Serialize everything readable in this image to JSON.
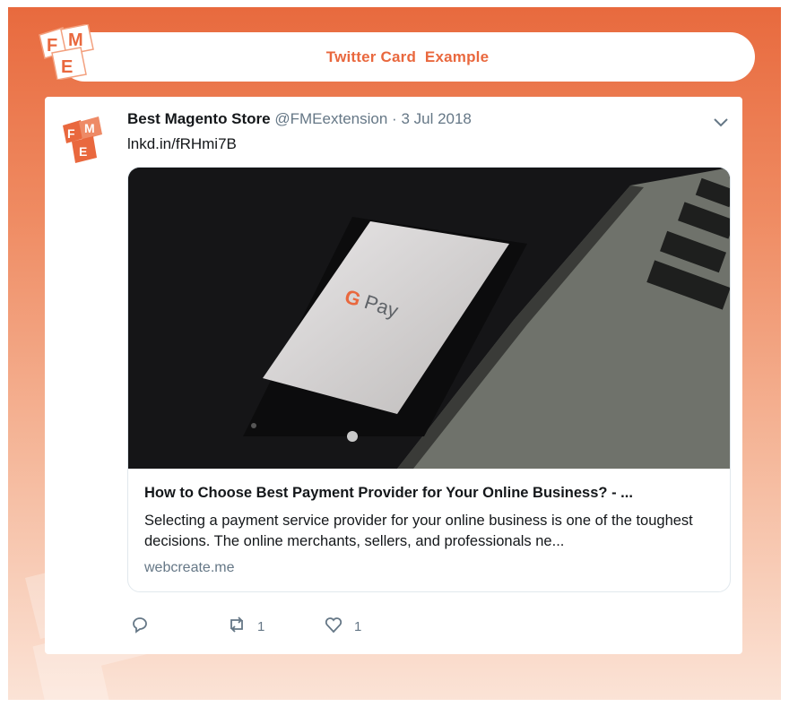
{
  "header": {
    "title": "Twitter Card  Example",
    "logo_letters": [
      "F",
      "M",
      "E"
    ]
  },
  "tweet": {
    "author_name": "Best Magento Store",
    "handle": "@FMEextension",
    "separator": "·",
    "date": "3 Jul 2018",
    "text": "lnkd.in/fRHmi7B",
    "avatar_letters": [
      "F",
      "M",
      "E"
    ],
    "media": {
      "phone_brand_g": "G",
      "phone_brand_text": "Pay"
    },
    "link_card": {
      "title": "How to Choose Best Payment Provider for Your Online Business? - ...",
      "description": "Selecting a payment service provider for your online business is one of the toughest decisions. The online merchants, sellers, and professionals ne...",
      "domain": "webcreate.me"
    },
    "actions": {
      "reply_count": "",
      "retweet_count": "1",
      "like_count": "1"
    }
  },
  "colors": {
    "brand_orange": "#e9683e",
    "background_top": "#e86a3e",
    "background_bottom": "#fbe3d6",
    "muted_text": "#657786"
  },
  "icons": [
    "chevron-down-icon",
    "reply-icon",
    "retweet-icon",
    "heart-icon"
  ]
}
